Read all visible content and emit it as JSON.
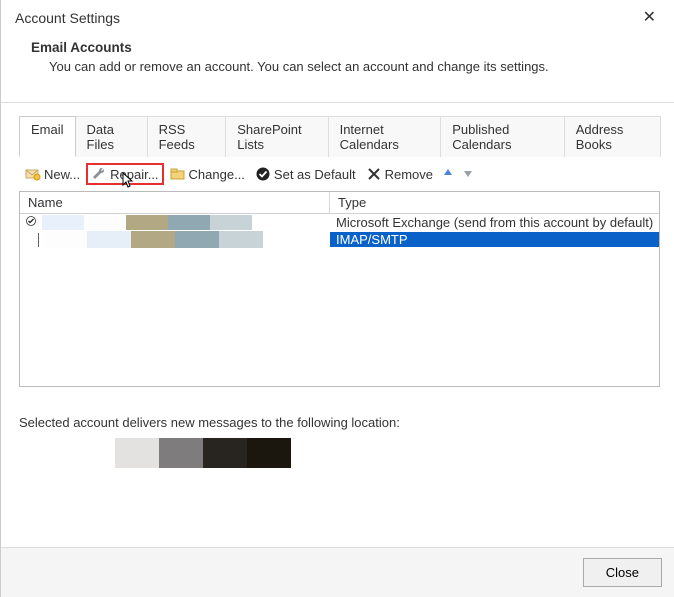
{
  "window": {
    "title": "Account Settings"
  },
  "header": {
    "title": "Email Accounts",
    "description": "You can add or remove an account. You can select an account and change its settings."
  },
  "tabs": [
    {
      "id": "email",
      "label": "Email",
      "active": true
    },
    {
      "id": "datafiles",
      "label": "Data Files",
      "active": false
    },
    {
      "id": "rss",
      "label": "RSS Feeds",
      "active": false
    },
    {
      "id": "sharepoint",
      "label": "SharePoint Lists",
      "active": false
    },
    {
      "id": "intcal",
      "label": "Internet Calendars",
      "active": false
    },
    {
      "id": "pubcal",
      "label": "Published Calendars",
      "active": false
    },
    {
      "id": "addr",
      "label": "Address Books",
      "active": false
    }
  ],
  "toolbar": {
    "new_label": "New...",
    "repair_label": "Repair...",
    "change_label": "Change...",
    "default_label": "Set as Default",
    "remove_label": "Remove"
  },
  "columns": {
    "name": "Name",
    "type": "Type"
  },
  "rows": [
    {
      "default": true,
      "type": "Microsoft Exchange (send from this account by default)",
      "selected": false
    },
    {
      "default": false,
      "type": "IMAP/SMTP",
      "selected": true
    }
  ],
  "footer": {
    "text": "Selected account delivers new messages to the following location:"
  },
  "buttons": {
    "close": "Close"
  },
  "row1_swatches": [
    "#e8f1fb",
    "#fdfdfd",
    "#b2a884",
    "#8fa8b1",
    "#c8d3d8"
  ],
  "row2_swatches": [
    "#fdfdfd",
    "#e6eef7",
    "#b2a884",
    "#8fa8b1",
    "#c8d3d8"
  ],
  "loc_swatches": [
    "#e3e2e1",
    "#7e7c7c",
    "#28241f",
    "#1b170f"
  ]
}
